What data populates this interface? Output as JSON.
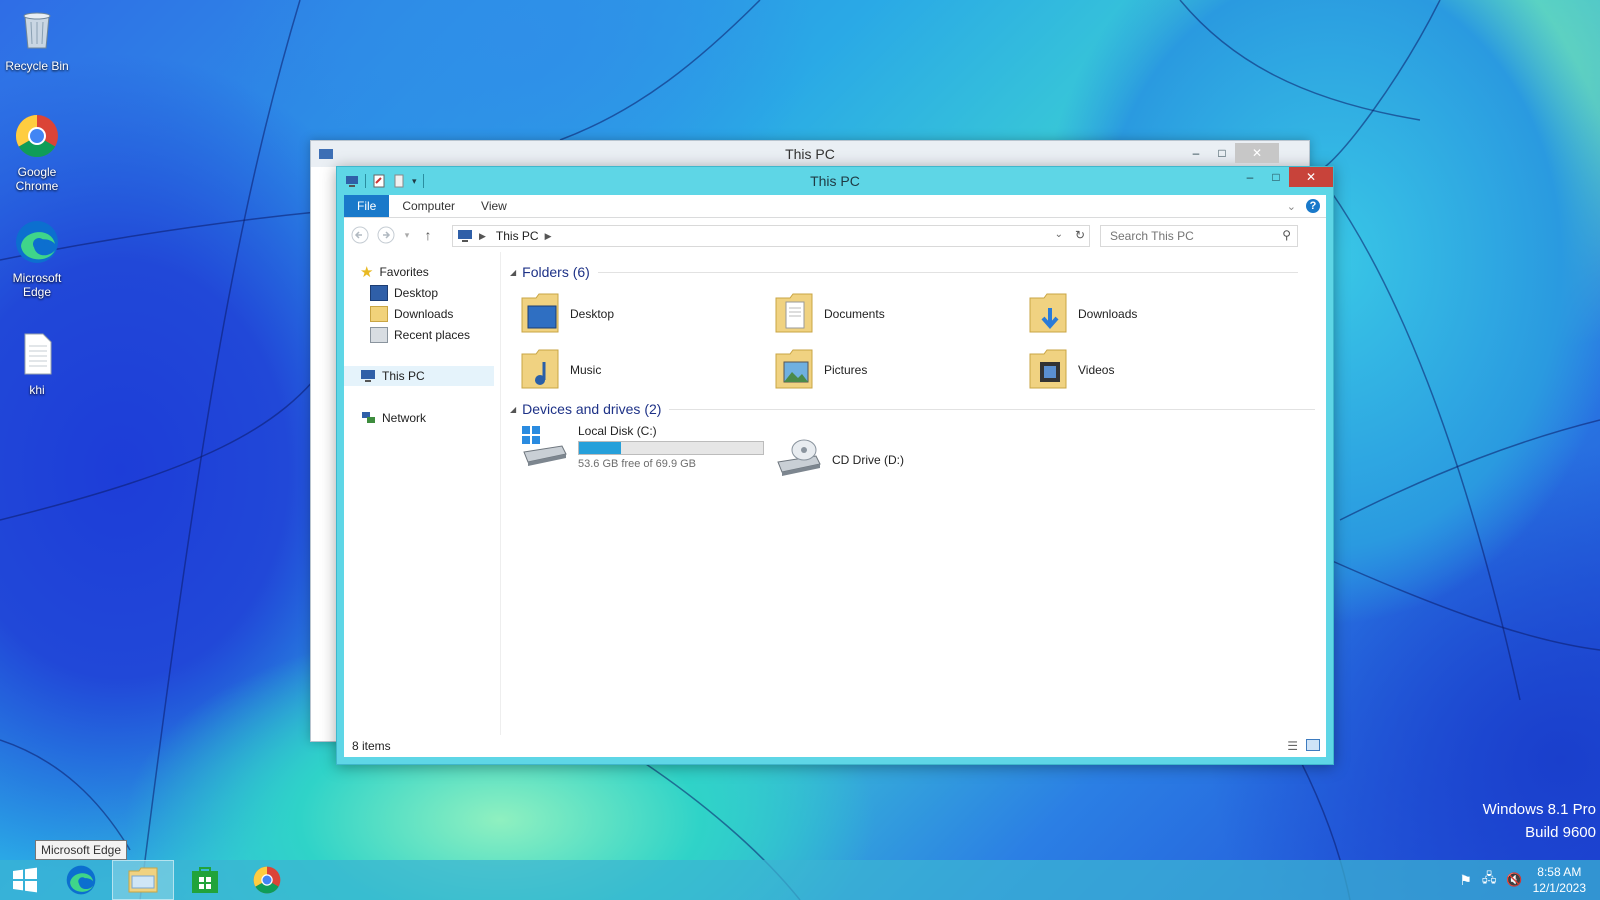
{
  "desktop": {
    "icons": [
      {
        "label": "Recycle Bin"
      },
      {
        "label": "Google Chrome"
      },
      {
        "label": "Microsoft Edge"
      },
      {
        "label": "khi"
      }
    ],
    "watermark": {
      "line1": "Windows 8.1 Pro",
      "line2": "Build 9600"
    }
  },
  "back_window": {
    "title": "This PC"
  },
  "window": {
    "title": "This PC",
    "ribbon_tabs": [
      "File",
      "Computer",
      "View"
    ],
    "address": {
      "crumb": "This PC"
    },
    "search": {
      "placeholder": "Search This PC"
    },
    "nav_pane": {
      "favorites": "Favorites",
      "favorite_items": [
        "Desktop",
        "Downloads",
        "Recent places"
      ],
      "this_pc": "This PC",
      "network": "Network"
    },
    "folders_header": "Folders (6)",
    "folders": [
      "Desktop",
      "Documents",
      "Downloads",
      "Music",
      "Pictures",
      "Videos"
    ],
    "devices_header": "Devices and drives (2)",
    "drives": {
      "c": {
        "name": "Local Disk (C:)",
        "free_text": "53.6 GB free of 69.9 GB",
        "used_fraction": 0.23
      },
      "d": {
        "name": "CD Drive (D:)"
      }
    },
    "status": "8 items"
  },
  "taskbar": {
    "tooltip": "Microsoft Edge",
    "clock": {
      "time": "8:58 AM",
      "date": "12/1/2023"
    }
  },
  "colors": {
    "accent": "#1979ca",
    "window_frame": "#5ed6e6",
    "drive_fill": "#26a0da"
  }
}
